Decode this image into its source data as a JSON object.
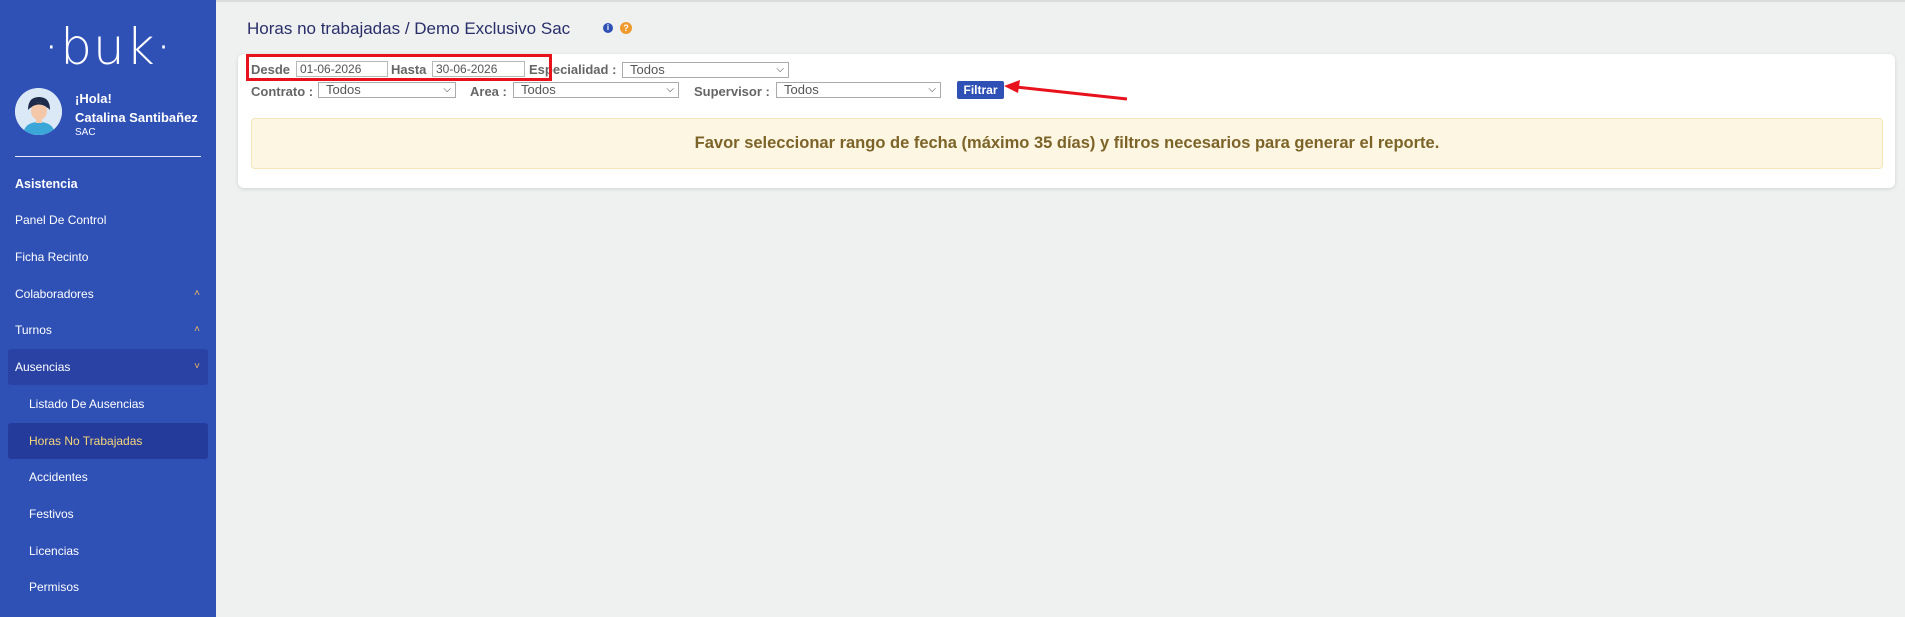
{
  "sidebar": {
    "logo": "·buk·",
    "greeting": "¡Hola!",
    "user_name": "Catalina Santibañez",
    "role": "SAC",
    "items": [
      {
        "label": "Asistencia"
      },
      {
        "label": "Panel De Control"
      },
      {
        "label": "Ficha Recinto"
      },
      {
        "label": "Colaboradores"
      },
      {
        "label": "Turnos"
      },
      {
        "label": "Ausencias"
      },
      {
        "label": "Listado De Ausencias"
      },
      {
        "label": "Horas No Trabajadas"
      },
      {
        "label": "Accidentes"
      },
      {
        "label": "Festivos"
      },
      {
        "label": "Licencias"
      },
      {
        "label": "Permisos"
      }
    ]
  },
  "page": {
    "title": "Horas no trabajadas / Demo Exclusivo Sac"
  },
  "filters": {
    "desde_label": "Desde",
    "desde_value": "01-06-2026",
    "hasta_label": "Hasta",
    "hasta_value": "30-06-2026",
    "especialidad_label": "Especialidad :",
    "especialidad_value": "Todos",
    "contrato_label": "Contrato :",
    "contrato_value": "Todos",
    "area_label": "Area :",
    "area_value": "Todos",
    "supervisor_label": "Supervisor :",
    "supervisor_value": "Todos",
    "filter_button": "Filtrar"
  },
  "notice": "Favor seleccionar rango de fecha (máximo 35 días) y filtros necesarios para generar el reporte.",
  "colors": {
    "sidebar": "#2f50b5",
    "active_text": "#f6d77a",
    "highlight": "#e8121c"
  }
}
